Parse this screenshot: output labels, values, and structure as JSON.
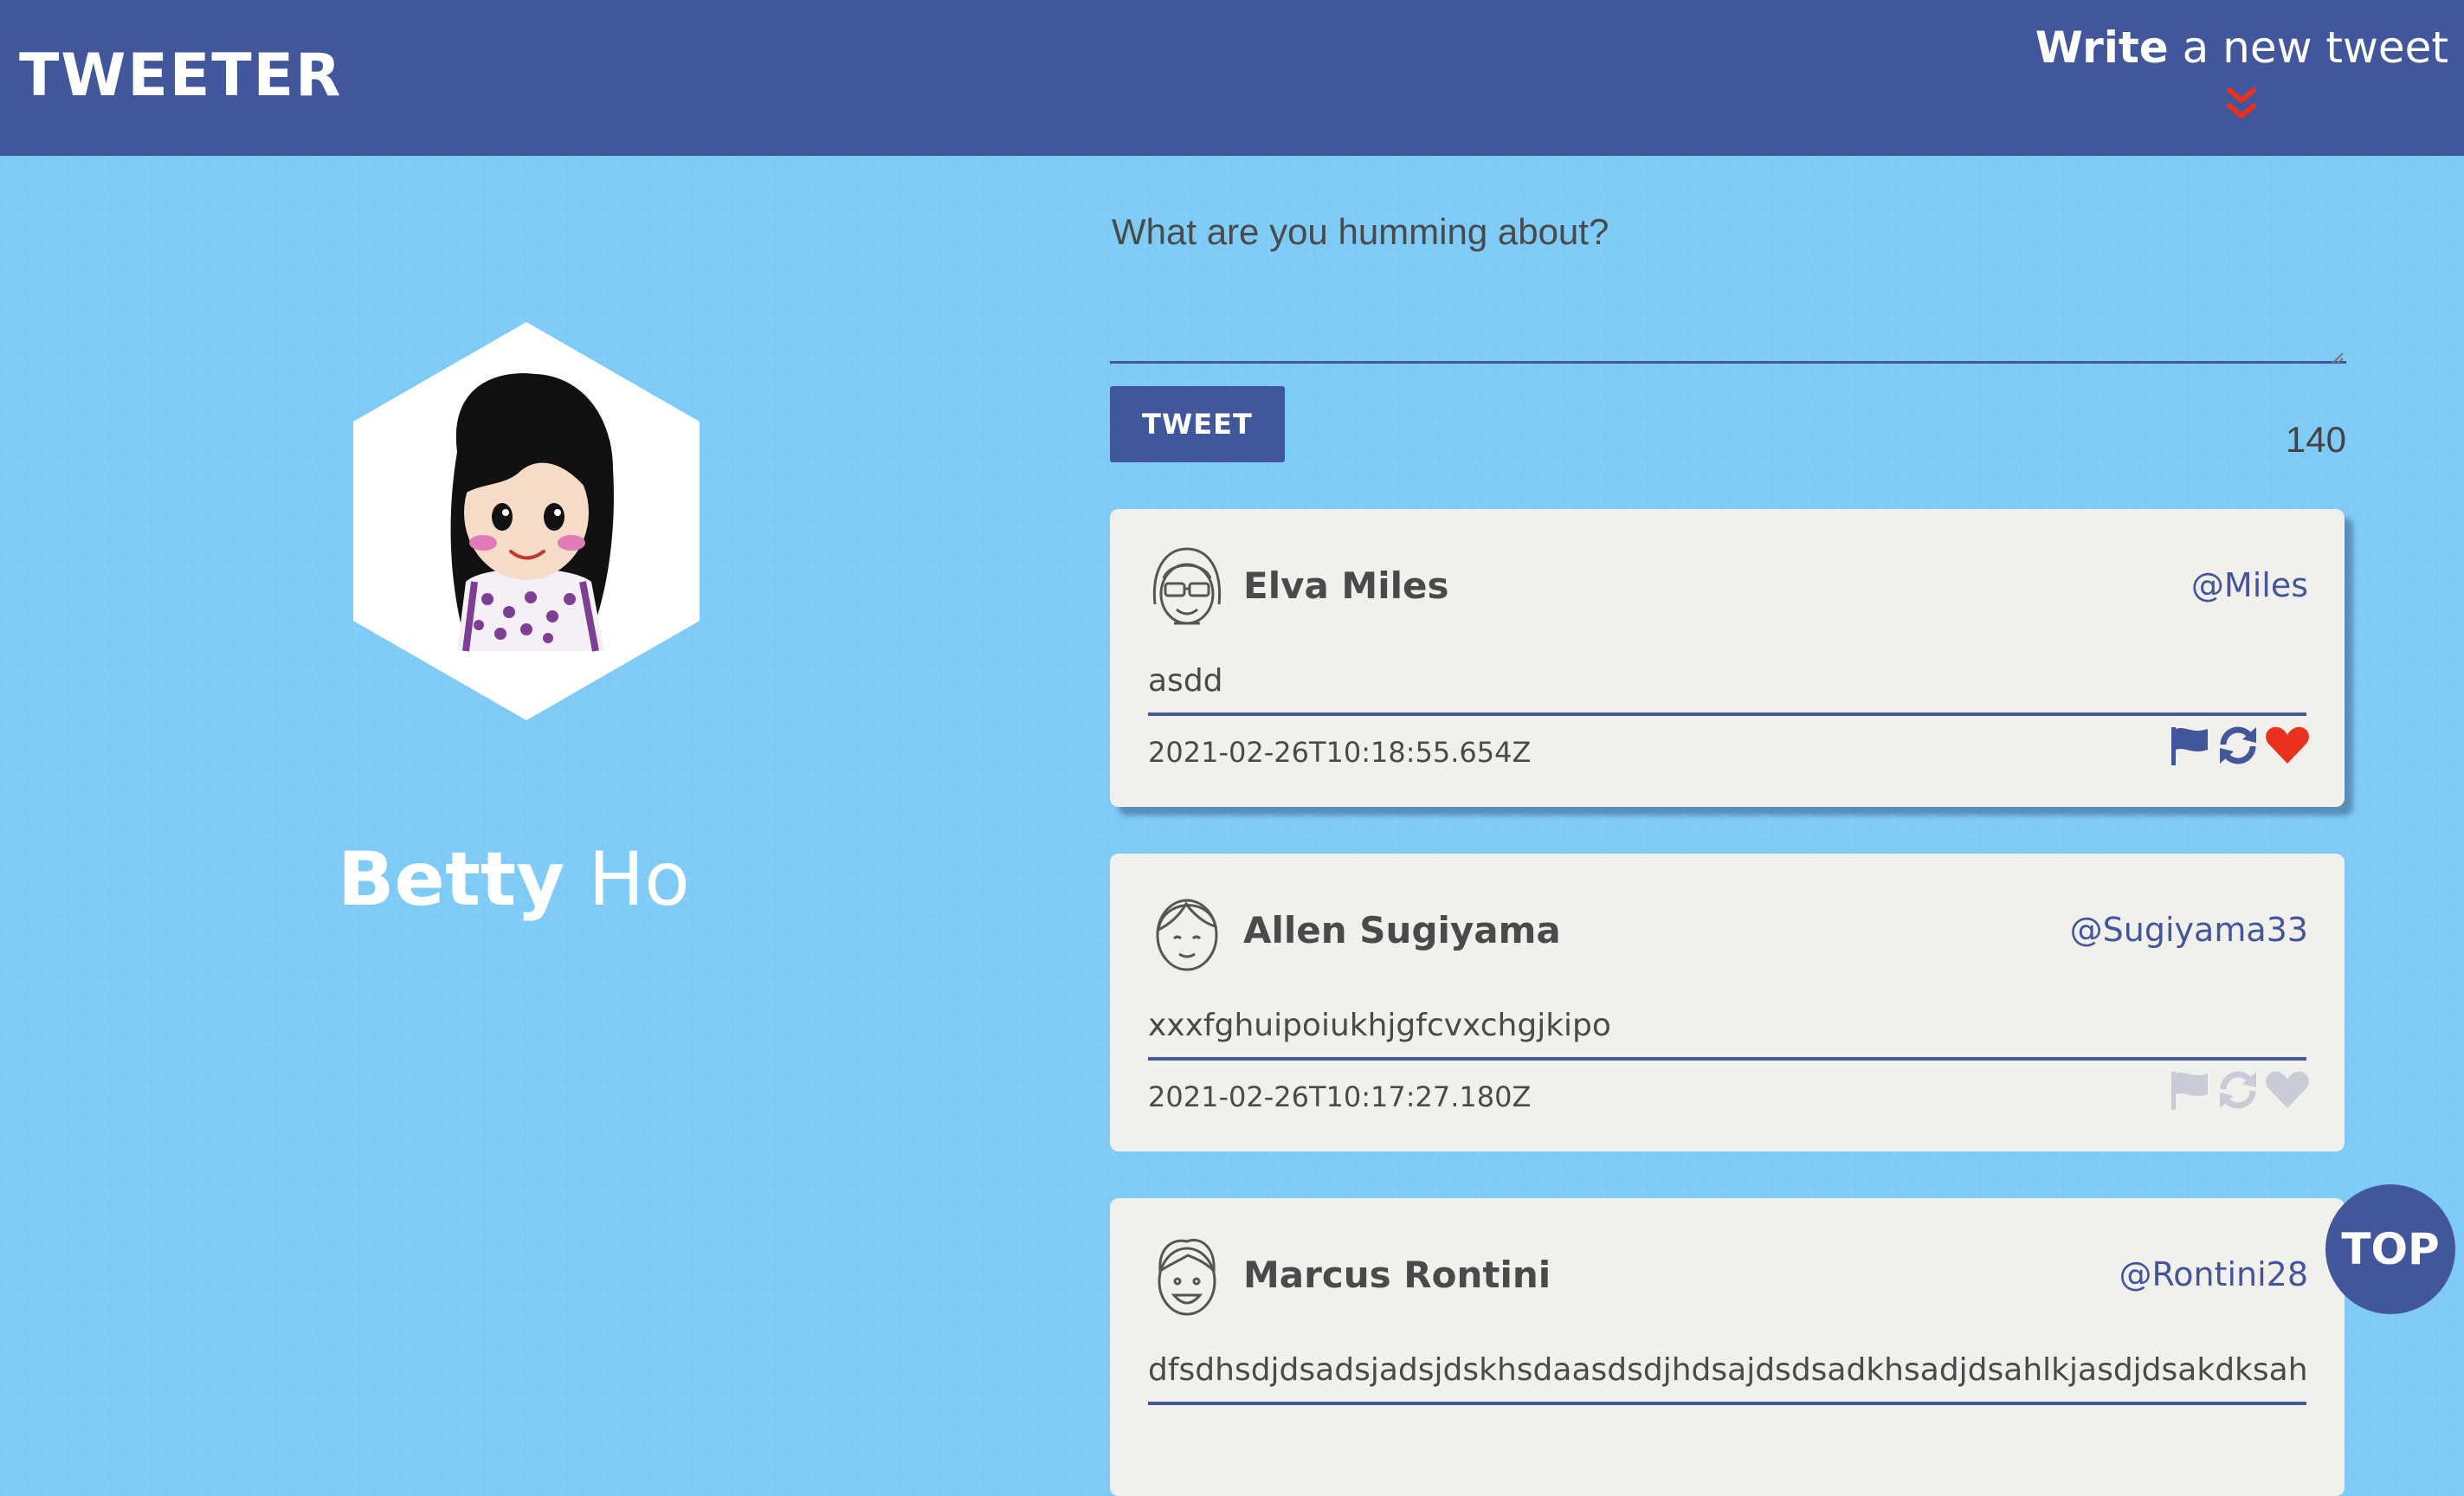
{
  "header": {
    "logo": "TWEETER",
    "write_bold": "Write",
    "write_rest": "a new tweet"
  },
  "profile": {
    "first_name": "Betty",
    "last_name": "Ho"
  },
  "composer": {
    "placeholder": "What are you humming about?",
    "value": "",
    "tweet_label": "TWEET",
    "counter": "140"
  },
  "tweets": [
    {
      "name": "Elva Miles",
      "handle": "@Miles",
      "content": "asdd",
      "timestamp": "2021-02-26T10:18:55.654Z",
      "actions_active": true
    },
    {
      "name": "Allen Sugiyama",
      "handle": "@Sugiyama33",
      "content": "xxxfghuipoiukhjgfcvxchgjkipo",
      "timestamp": "2021-02-26T10:17:27.180Z",
      "actions_active": false
    },
    {
      "name": "Marcus Rontini",
      "handle": "@Rontini28",
      "content": "dfsdhsdjdsadsjadsjdskhsdaasdsdjhdsajdsdsadkhsadjdsahlkjasdjdsakdksahdsakdskhdsd",
      "timestamp": "",
      "actions_active": false
    }
  ],
  "top_label": "TOP",
  "colors": {
    "brand": "#42569c",
    "background": "#7ecbf7",
    "card": "#f2f0ec",
    "heart_active": "#e8321f",
    "icon_inactive": "#c9ccd6"
  },
  "icons": {
    "scroll_down": "double-chevron-down-icon",
    "flag": "flag-icon",
    "retweet": "retweet-icon",
    "like": "heart-icon"
  }
}
